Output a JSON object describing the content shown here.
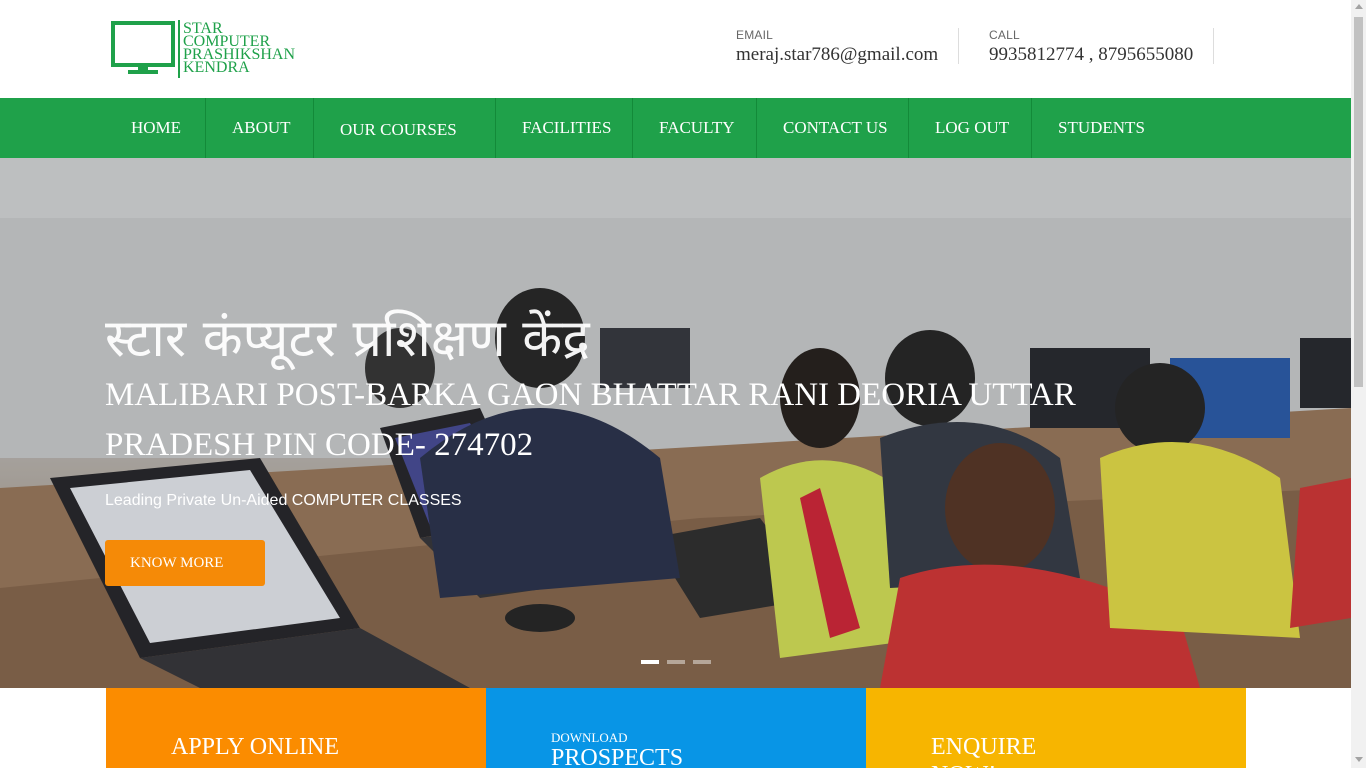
{
  "brand": {
    "logo_lines": [
      "STAR",
      "COMPUTER",
      "PRASHIKSHAN",
      "KENDRA"
    ],
    "color": "#1fa14a"
  },
  "contact": {
    "email_label": "EMAIL",
    "email_value": "meraj.star786@gmail.com",
    "call_label": "CALL",
    "call_value": "9935812774 , 8795655080"
  },
  "nav": {
    "items": [
      {
        "label": "HOME"
      },
      {
        "label": "ABOUT"
      },
      {
        "label": "OUR COURSES"
      },
      {
        "label": "FACILITIES"
      },
      {
        "label": "FACULTY"
      },
      {
        "label": "CONTACT US"
      },
      {
        "label": "LOG OUT"
      },
      {
        "label": "STUDENTS"
      }
    ],
    "bg_color": "#1fa14a"
  },
  "hero": {
    "title": "स्टार कंप्यूटर प्रशिक्षण केंद्र",
    "address": "MALIBARI POST-BARKA GAON BHATTAR RANI DEORIA UTTAR PRADESH PIN CODE- 274702",
    "tagline": "Leading Private Un-Aided COMPUTER CLASSES",
    "button_label": "KNOW MORE",
    "button_color": "#f58a07",
    "slides": 3,
    "active_slide": 1
  },
  "actions": {
    "apply": {
      "title": "APPLY ONLINE",
      "color": "#fb8c00"
    },
    "download": {
      "small": "DOWNLOAD",
      "title": "PROSPECTS",
      "color": "#0895e6"
    },
    "enquire": {
      "title": "ENQUIRE NOW!",
      "color": "#f7b500"
    }
  }
}
